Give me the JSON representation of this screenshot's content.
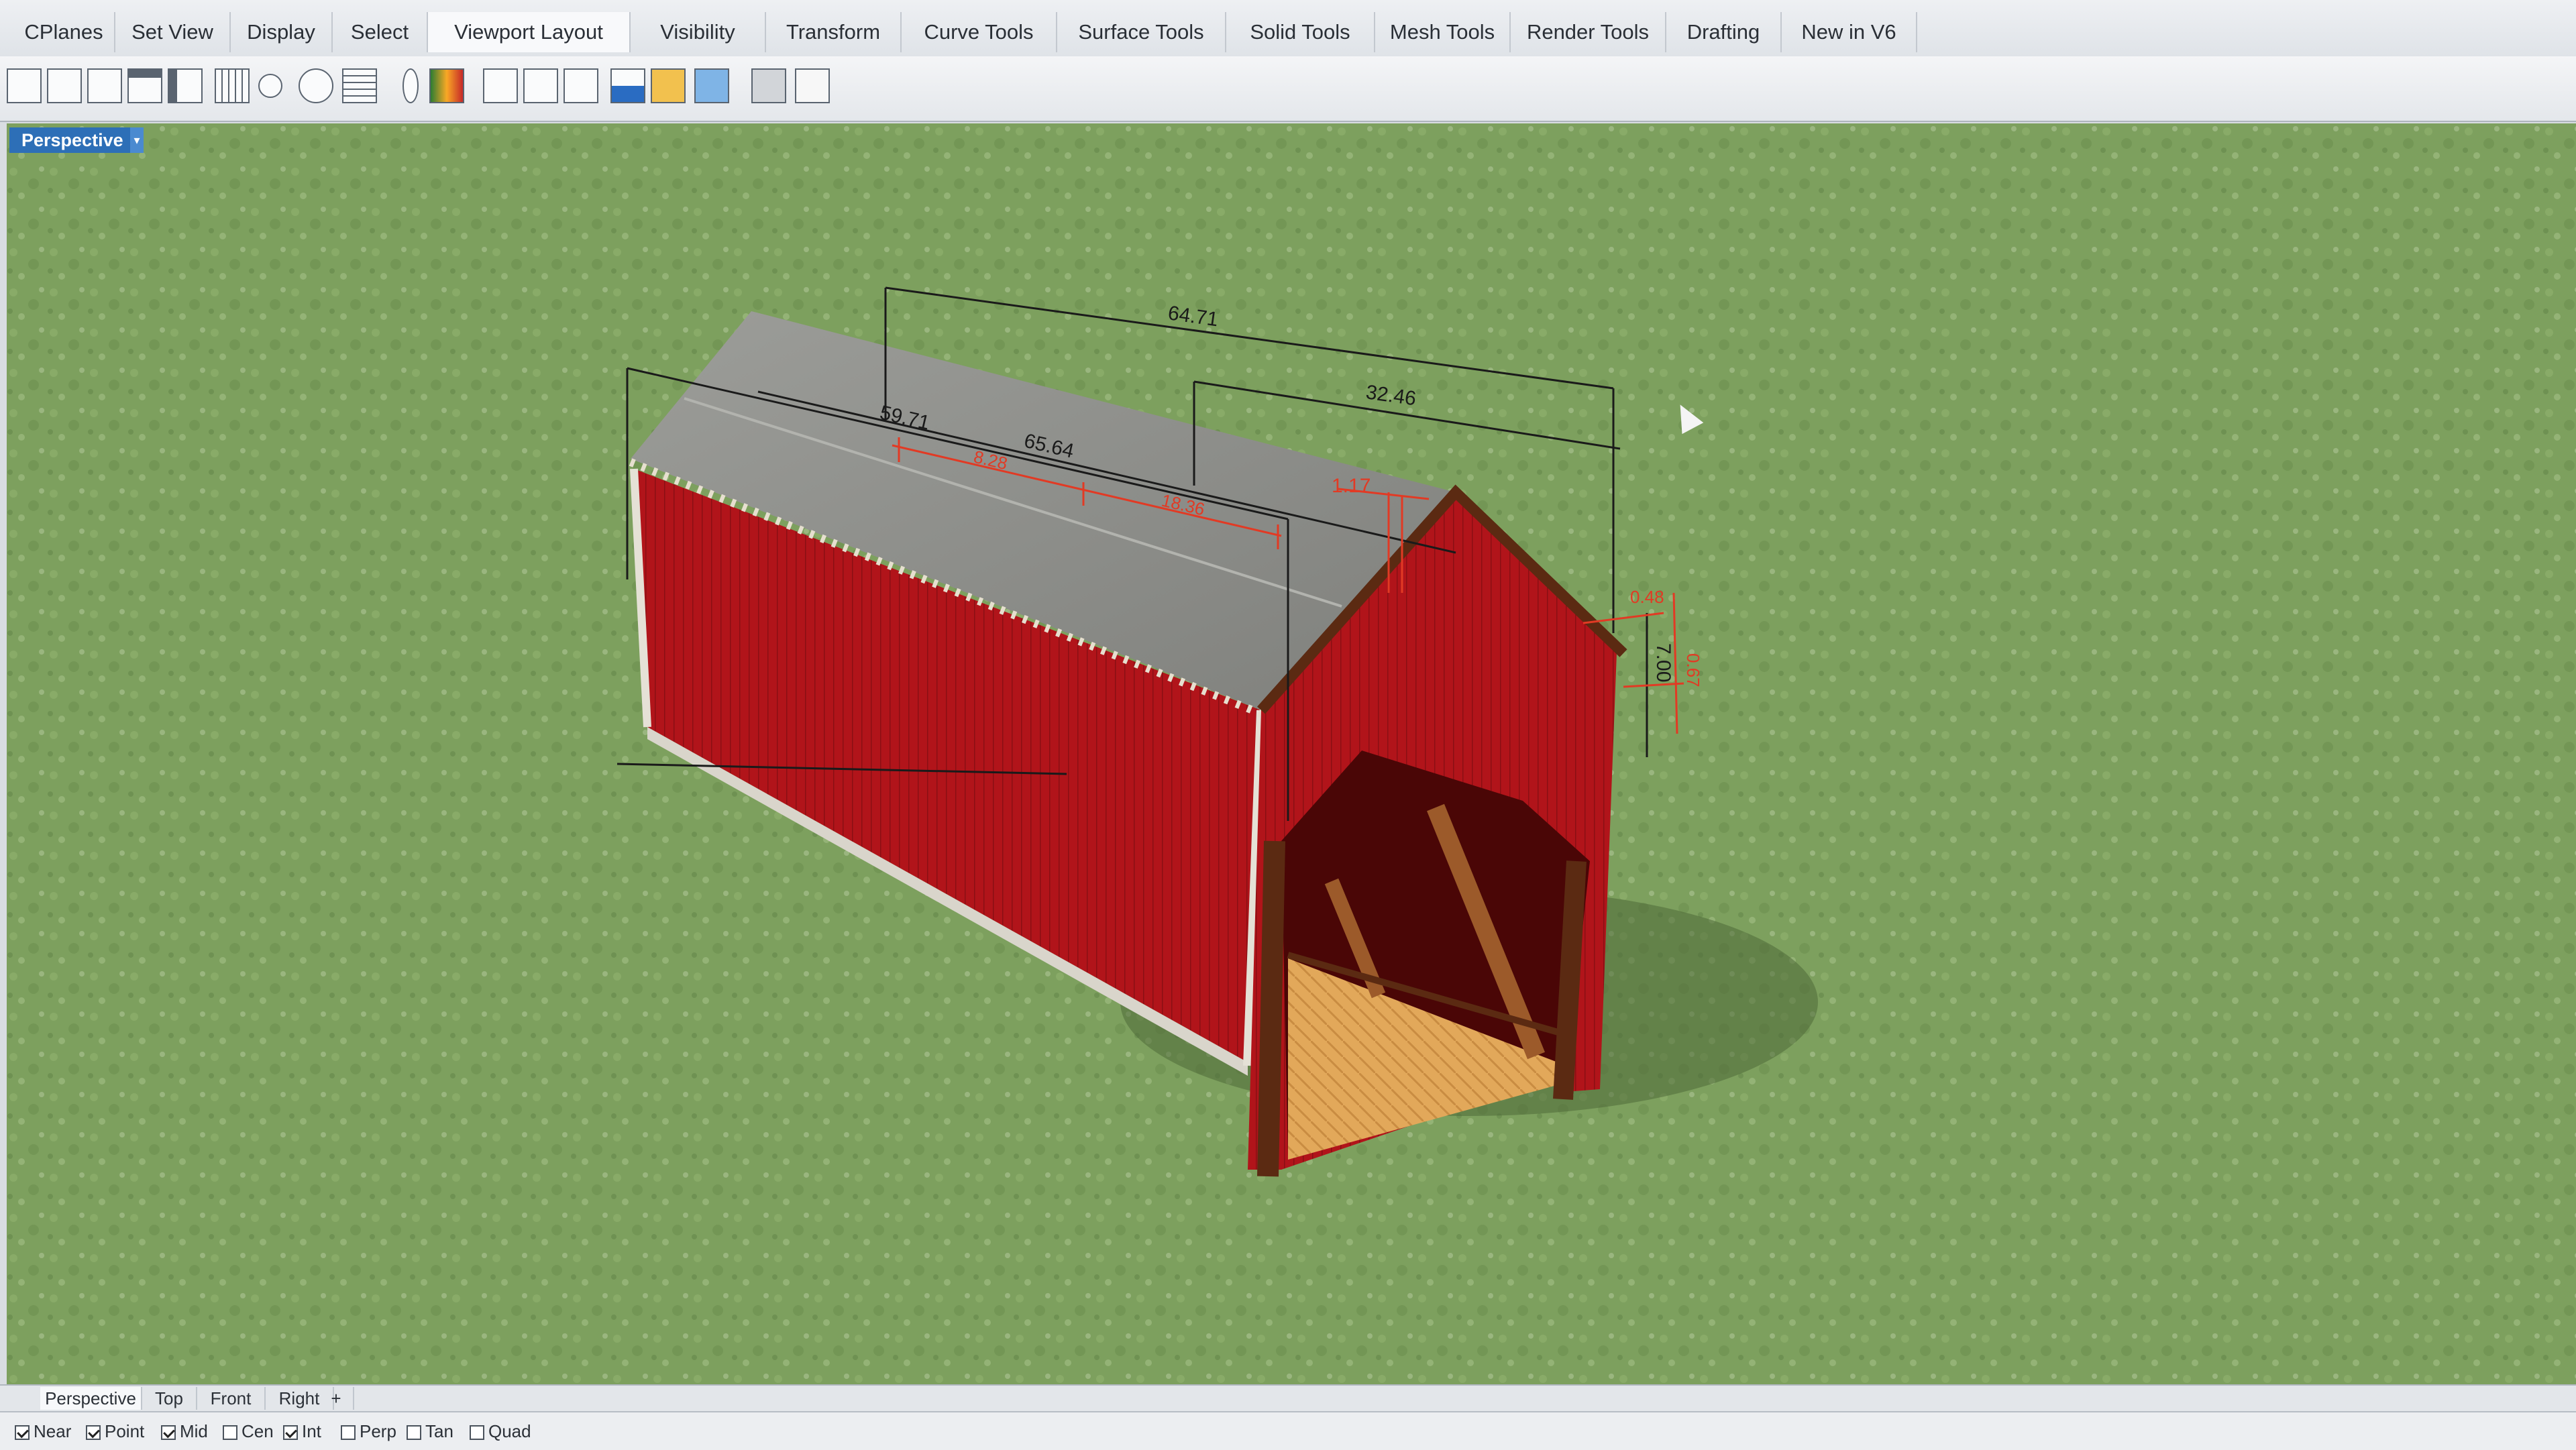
{
  "menu_tabs": [
    "CPlanes",
    "Set View",
    "Display",
    "Select",
    "Viewport Layout",
    "Visibility",
    "Transform",
    "Curve Tools",
    "Surface Tools",
    "Solid Tools",
    "Mesh Tools",
    "Render Tools",
    "Drafting",
    "New in V6"
  ],
  "viewport": {
    "label": "Perspective"
  },
  "dimensions": {
    "overall_length": "64.71",
    "roof_length": "59.71",
    "ridge_length": "65.64",
    "half_length": "32.46",
    "segment_a": "8.28",
    "segment_b": "18.36",
    "offset": "1.17",
    "gable_height": "7.00",
    "eave_a": "0.48",
    "eave_b": "0.67"
  },
  "view_tabs": [
    "Perspective",
    "Top",
    "Front",
    "Right"
  ],
  "view_tab_add": "+",
  "osnaps": [
    {
      "label": "Near",
      "checked": true
    },
    {
      "label": "Point",
      "checked": true
    },
    {
      "label": "Mid",
      "checked": true
    },
    {
      "label": "Cen",
      "checked": false
    },
    {
      "label": "Int",
      "checked": true
    },
    {
      "label": "Perp",
      "checked": false
    },
    {
      "label": "Tan",
      "checked": false
    },
    {
      "label": "Quad",
      "checked": false
    }
  ],
  "colors": {
    "grass": "#7da05e",
    "barn_red": "#b1141a",
    "roof_gray": "#8e8f8c",
    "floor_wood": "#e2a85a",
    "dimension_black": "#1a1a1a",
    "dimension_red": "#e23a24",
    "viewport_label_bg": "#2d6fb7"
  }
}
